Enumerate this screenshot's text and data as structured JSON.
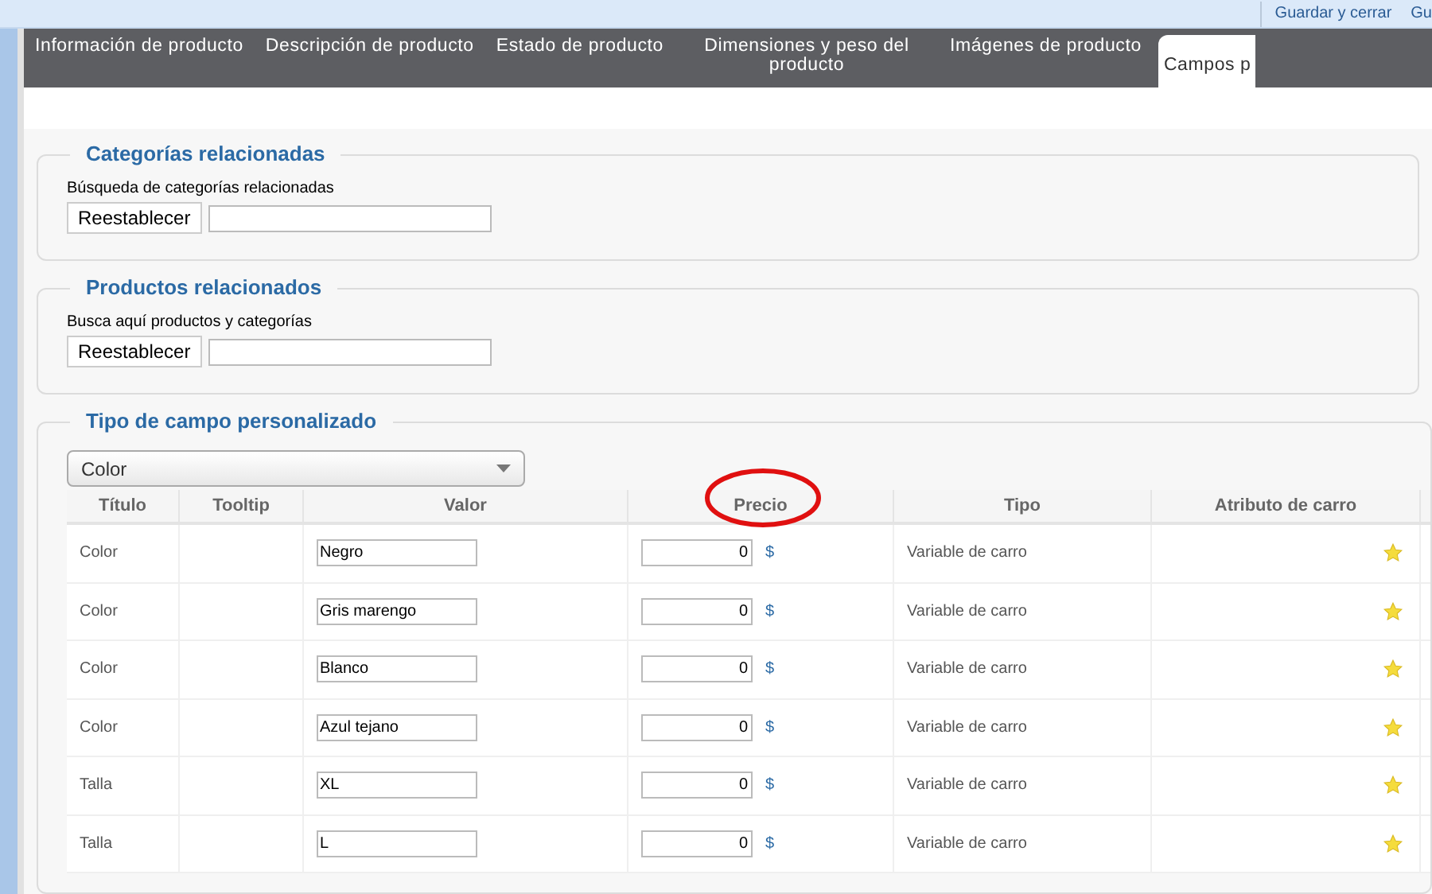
{
  "toolbar": {
    "buttons": [
      "Guardar y cerrar",
      "Gu"
    ]
  },
  "tabs": [
    {
      "label": "Información de producto",
      "selected": false
    },
    {
      "label": "Descripción de producto",
      "selected": false
    },
    {
      "label": "Estado de producto",
      "selected": false
    },
    {
      "label": "Dimensiones y peso del producto",
      "selected": false
    },
    {
      "label": "Imágenes de producto",
      "selected": false
    },
    {
      "label": "Campos p",
      "selected": true
    }
  ],
  "related_categories": {
    "legend": "Categorías relacionadas",
    "label": "Búsqueda de categorías relacionadas",
    "button": "Reestablecer"
  },
  "related_products": {
    "legend": "Productos relacionados",
    "label": "Busca aquí productos y categorías",
    "button": "Reestablecer"
  },
  "custom_field": {
    "legend": "Tipo de campo personalizado",
    "select": "Color",
    "table": {
      "columns": [
        "Título",
        "Tooltip",
        "Valor",
        "Precio",
        "Tipo",
        "Atributo de carro"
      ],
      "rows": [
        {
          "title": "Color",
          "value": "Negro",
          "price": "0",
          "currency": "$",
          "type": "Variable de carro"
        },
        {
          "title": "Color",
          "value": "Gris marengo",
          "price": "0",
          "currency": "$",
          "type": "Variable de carro"
        },
        {
          "title": "Color",
          "value": "Blanco",
          "price": "0",
          "currency": "$",
          "type": "Variable de carro"
        },
        {
          "title": "Color",
          "value": "Azul tejano",
          "price": "0",
          "currency": "$",
          "type": "Variable de carro"
        },
        {
          "title": "Talla",
          "value": "XL",
          "price": "0",
          "currency": "$",
          "type": "Variable de carro"
        },
        {
          "title": "Talla",
          "value": "L",
          "price": "0",
          "currency": "$",
          "type": "Variable de carro"
        }
      ]
    }
  }
}
